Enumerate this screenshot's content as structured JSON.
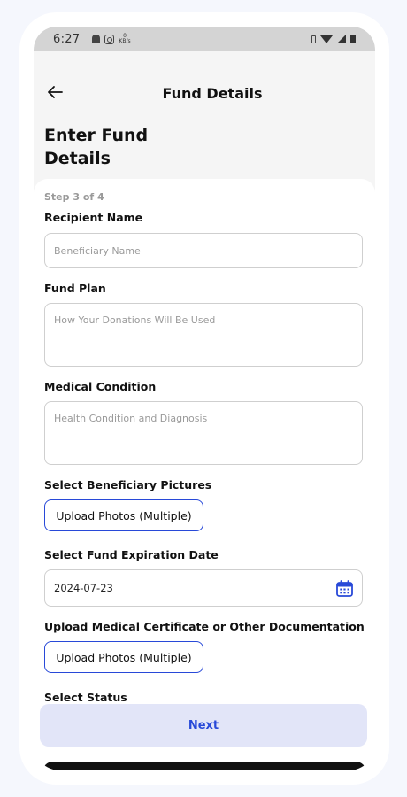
{
  "status_bar": {
    "time": "6:27",
    "data_rate_value": "0",
    "data_rate_unit": "KB/s"
  },
  "header": {
    "title": "Fund Details",
    "heading": "Enter Fund Details"
  },
  "form": {
    "step": "Step 3 of 4",
    "recipient_name": {
      "label": "Recipient Name",
      "placeholder": "Beneficiary Name",
      "value": ""
    },
    "fund_plan": {
      "label": "Fund Plan",
      "placeholder": "How Your Donations Will Be Used",
      "value": ""
    },
    "medical_condition": {
      "label": "Medical Condition",
      "placeholder": "Health Condition and Diagnosis",
      "value": ""
    },
    "beneficiary_pictures": {
      "label": "Select Beneficiary Pictures",
      "button_label": "Upload Photos (Multiple)"
    },
    "expiration_date": {
      "label": "Select Fund Expiration Date",
      "value": "2024-07-23"
    },
    "medical_certificate": {
      "label": "Upload Medical Certificate or Other Documentation",
      "button_label": "Upload Photos (Multiple)"
    },
    "status": {
      "label": "Select Status"
    }
  },
  "actions": {
    "next_label": "Next"
  },
  "colors": {
    "accent": "#2849d8",
    "next_bg": "#e2e5f8",
    "header_bg": "#f5f5f5"
  }
}
